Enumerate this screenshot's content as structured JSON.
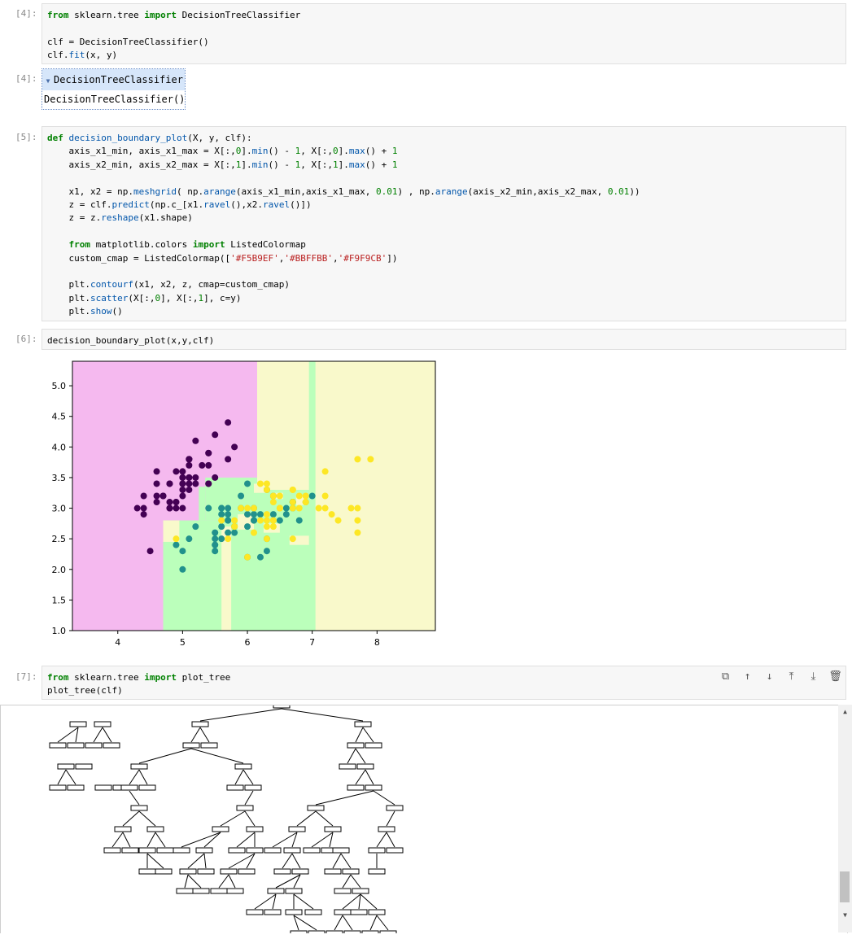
{
  "cells": {
    "c4": {
      "prompt": "[4]:",
      "out_prompt": "[4]:",
      "lines": [
        [
          [
            "kw",
            "from"
          ],
          [
            "cm",
            " sklearn.tree "
          ],
          [
            "kw",
            "import"
          ],
          [
            "cm",
            " DecisionTreeClassifier"
          ]
        ],
        [],
        [
          [
            "cm",
            "clf = DecisionTreeClassifier()"
          ]
        ],
        [
          [
            "cm",
            "clf."
          ],
          [
            "fn",
            "fit"
          ],
          [
            "cm",
            "(x, y)"
          ]
        ]
      ],
      "repr_title": "DecisionTreeClassifier",
      "repr_text": "DecisionTreeClassifier()"
    },
    "c5": {
      "prompt": "[5]:",
      "lines": [
        [
          [
            "kw",
            "def"
          ],
          [
            "cm",
            " "
          ],
          [
            "fn",
            "decision_boundary_plot"
          ],
          [
            "cm",
            "(X, y, clf):"
          ]
        ],
        [
          [
            "cm",
            "    axis_x1_min, axis_x1_max = X[:,"
          ],
          [
            "num",
            "0"
          ],
          [
            "cm",
            "]."
          ],
          [
            "fn",
            "min"
          ],
          [
            "cm",
            "() - "
          ],
          [
            "num",
            "1"
          ],
          [
            "cm",
            ", X[:,"
          ],
          [
            "num",
            "0"
          ],
          [
            "cm",
            "]."
          ],
          [
            "fn",
            "max"
          ],
          [
            "cm",
            "() + "
          ],
          [
            "num",
            "1"
          ]
        ],
        [
          [
            "cm",
            "    axis_x2_min, axis_x2_max = X[:,"
          ],
          [
            "num",
            "1"
          ],
          [
            "cm",
            "]."
          ],
          [
            "fn",
            "min"
          ],
          [
            "cm",
            "() - "
          ],
          [
            "num",
            "1"
          ],
          [
            "cm",
            ", X[:,"
          ],
          [
            "num",
            "1"
          ],
          [
            "cm",
            "]."
          ],
          [
            "fn",
            "max"
          ],
          [
            "cm",
            "() + "
          ],
          [
            "num",
            "1"
          ]
        ],
        [],
        [
          [
            "cm",
            "    x1, x2 = np."
          ],
          [
            "fn",
            "meshgrid"
          ],
          [
            "cm",
            "( np."
          ],
          [
            "fn",
            "arange"
          ],
          [
            "cm",
            "(axis_x1_min,axis_x1_max, "
          ],
          [
            "num",
            "0.01"
          ],
          [
            "cm",
            ") , np."
          ],
          [
            "fn",
            "arange"
          ],
          [
            "cm",
            "(axis_x2_min,axis_x2_max, "
          ],
          [
            "num",
            "0.01"
          ],
          [
            "cm",
            "))"
          ]
        ],
        [
          [
            "cm",
            "    z = clf."
          ],
          [
            "fn",
            "predict"
          ],
          [
            "cm",
            "(np.c_[x1."
          ],
          [
            "fn",
            "ravel"
          ],
          [
            "cm",
            "(),x2."
          ],
          [
            "fn",
            "ravel"
          ],
          [
            "cm",
            "()])"
          ]
        ],
        [
          [
            "cm",
            "    z = z."
          ],
          [
            "fn",
            "reshape"
          ],
          [
            "cm",
            "(x1.shape)"
          ]
        ],
        [],
        [
          [
            "kw",
            "    from"
          ],
          [
            "cm",
            " matplotlib.colors "
          ],
          [
            "kw",
            "import"
          ],
          [
            "cm",
            " ListedColormap"
          ]
        ],
        [
          [
            "cm",
            "    custom_cmap = ListedColormap(["
          ],
          [
            "str",
            "'#F5B9EF'"
          ],
          [
            "cm",
            ","
          ],
          [
            "str",
            "'#BBFFBB'"
          ],
          [
            "cm",
            ","
          ],
          [
            "str",
            "'#F9F9CB'"
          ],
          [
            "cm",
            "])"
          ]
        ],
        [],
        [
          [
            "cm",
            "    plt."
          ],
          [
            "fn",
            "contourf"
          ],
          [
            "cm",
            "(x1, x2, z, cmap=custom_cmap)"
          ]
        ],
        [
          [
            "cm",
            "    plt."
          ],
          [
            "fn",
            "scatter"
          ],
          [
            "cm",
            "(X[:,"
          ],
          [
            "num",
            "0"
          ],
          [
            "cm",
            "], X[:,"
          ],
          [
            "num",
            "1"
          ],
          [
            "cm",
            "], c=y)"
          ]
        ],
        [
          [
            "cm",
            "    plt."
          ],
          [
            "fn",
            "show"
          ],
          [
            "cm",
            "()"
          ]
        ]
      ]
    },
    "c6": {
      "prompt": "[6]:",
      "lines": [
        [
          [
            "cm",
            "decision_boundary_plot(x,y,clf)"
          ]
        ]
      ]
    },
    "c7": {
      "prompt": "[7]:",
      "lines": [
        [
          [
            "kw",
            "from"
          ],
          [
            "cm",
            " sklearn.tree "
          ],
          [
            "kw",
            "import"
          ],
          [
            "cm",
            " plot_tree"
          ]
        ],
        [
          [
            "cm",
            "plot_tree(clf)"
          ]
        ]
      ]
    }
  },
  "toolbar": {
    "icons": [
      "copy-icon",
      "arrow-up-icon",
      "arrow-down-icon",
      "insert-above-icon",
      "insert-below-icon",
      "trash-icon"
    ],
    "glyphs": [
      "⧉",
      "↑",
      "↓",
      "⤒",
      "⤓",
      "🗑"
    ]
  },
  "chart_data": {
    "type": "scatter",
    "title": "",
    "xlabel": "",
    "ylabel": "",
    "xlim": [
      3.3,
      8.9
    ],
    "ylim": [
      1.0,
      5.4
    ],
    "xticks": [
      "4",
      "5",
      "6",
      "7",
      "8"
    ],
    "yticks": [
      "1.0",
      "1.5",
      "2.0",
      "2.5",
      "3.0",
      "3.5",
      "4.0",
      "4.5",
      "5.0"
    ],
    "region_colors": [
      "#F5B9EF",
      "#BBFFBB",
      "#F9F9CB"
    ],
    "point_colors": [
      "#440154",
      "#21918c",
      "#fde725"
    ],
    "series": [
      {
        "class": 0,
        "points": [
          [
            5.1,
            3.5
          ],
          [
            4.9,
            3.0
          ],
          [
            4.7,
            3.2
          ],
          [
            4.6,
            3.1
          ],
          [
            5.0,
            3.6
          ],
          [
            5.4,
            3.9
          ],
          [
            4.6,
            3.4
          ],
          [
            5.0,
            3.4
          ],
          [
            4.4,
            2.9
          ],
          [
            4.9,
            3.1
          ],
          [
            5.4,
            3.7
          ],
          [
            4.8,
            3.4
          ],
          [
            4.8,
            3.0
          ],
          [
            4.3,
            3.0
          ],
          [
            5.8,
            4.0
          ],
          [
            5.7,
            4.4
          ],
          [
            5.4,
            3.9
          ],
          [
            5.1,
            3.5
          ],
          [
            5.7,
            3.8
          ],
          [
            5.1,
            3.8
          ],
          [
            5.4,
            3.4
          ],
          [
            5.1,
            3.7
          ],
          [
            4.6,
            3.6
          ],
          [
            5.1,
            3.3
          ],
          [
            4.8,
            3.4
          ],
          [
            5.0,
            3.0
          ],
          [
            5.0,
            3.4
          ],
          [
            5.2,
            3.5
          ],
          [
            5.2,
            3.4
          ],
          [
            4.7,
            3.2
          ],
          [
            4.8,
            3.1
          ],
          [
            5.4,
            3.4
          ],
          [
            5.2,
            4.1
          ],
          [
            5.5,
            4.2
          ],
          [
            4.9,
            3.1
          ],
          [
            5.0,
            3.2
          ],
          [
            5.5,
            3.5
          ],
          [
            4.9,
            3.6
          ],
          [
            4.4,
            3.0
          ],
          [
            5.1,
            3.4
          ],
          [
            5.0,
            3.5
          ],
          [
            4.5,
            2.3
          ],
          [
            4.4,
            3.2
          ],
          [
            5.0,
            3.5
          ],
          [
            5.1,
            3.8
          ],
          [
            4.8,
            3.0
          ],
          [
            5.1,
            3.8
          ],
          [
            4.6,
            3.2
          ],
          [
            5.3,
            3.7
          ],
          [
            5.0,
            3.3
          ]
        ]
      },
      {
        "class": 1,
        "points": [
          [
            7.0,
            3.2
          ],
          [
            6.4,
            3.2
          ],
          [
            6.9,
            3.1
          ],
          [
            5.5,
            2.3
          ],
          [
            6.5,
            2.8
          ],
          [
            5.7,
            2.8
          ],
          [
            6.3,
            3.3
          ],
          [
            4.9,
            2.4
          ],
          [
            6.6,
            2.9
          ],
          [
            5.2,
            2.7
          ],
          [
            5.0,
            2.0
          ],
          [
            5.9,
            3.0
          ],
          [
            6.0,
            2.2
          ],
          [
            6.1,
            2.9
          ],
          [
            5.6,
            2.9
          ],
          [
            6.7,
            3.1
          ],
          [
            5.6,
            3.0
          ],
          [
            5.8,
            2.7
          ],
          [
            6.2,
            2.2
          ],
          [
            5.6,
            2.5
          ],
          [
            5.9,
            3.2
          ],
          [
            6.1,
            2.8
          ],
          [
            6.3,
            2.5
          ],
          [
            6.1,
            2.8
          ],
          [
            6.4,
            2.9
          ],
          [
            6.6,
            3.0
          ],
          [
            6.8,
            2.8
          ],
          [
            6.7,
            3.0
          ],
          [
            6.0,
            2.9
          ],
          [
            5.7,
            2.6
          ],
          [
            5.5,
            2.4
          ],
          [
            5.5,
            2.4
          ],
          [
            5.8,
            2.7
          ],
          [
            6.0,
            2.7
          ],
          [
            5.4,
            3.0
          ],
          [
            6.0,
            3.4
          ],
          [
            6.7,
            3.1
          ],
          [
            6.3,
            2.3
          ],
          [
            5.6,
            3.0
          ],
          [
            5.5,
            2.5
          ],
          [
            5.5,
            2.6
          ],
          [
            6.1,
            3.0
          ],
          [
            5.8,
            2.6
          ],
          [
            5.0,
            2.3
          ],
          [
            5.6,
            2.7
          ],
          [
            5.7,
            3.0
          ],
          [
            5.7,
            2.9
          ],
          [
            6.2,
            2.9
          ],
          [
            5.1,
            2.5
          ],
          [
            5.7,
            2.8
          ]
        ]
      },
      {
        "class": 2,
        "points": [
          [
            6.3,
            3.3
          ],
          [
            5.8,
            2.7
          ],
          [
            7.1,
            3.0
          ],
          [
            6.3,
            2.9
          ],
          [
            6.5,
            3.0
          ],
          [
            7.6,
            3.0
          ],
          [
            4.9,
            2.5
          ],
          [
            7.3,
            2.9
          ],
          [
            6.7,
            2.5
          ],
          [
            7.2,
            3.6
          ],
          [
            6.5,
            3.2
          ],
          [
            6.4,
            2.7
          ],
          [
            6.8,
            3.0
          ],
          [
            5.7,
            2.5
          ],
          [
            5.8,
            2.8
          ],
          [
            6.4,
            3.2
          ],
          [
            6.5,
            3.0
          ],
          [
            7.7,
            3.8
          ],
          [
            7.7,
            2.6
          ],
          [
            6.0,
            2.2
          ],
          [
            6.9,
            3.2
          ],
          [
            5.6,
            2.8
          ],
          [
            7.7,
            2.8
          ],
          [
            6.3,
            2.7
          ],
          [
            6.7,
            3.3
          ],
          [
            7.2,
            3.2
          ],
          [
            6.2,
            2.8
          ],
          [
            6.1,
            3.0
          ],
          [
            6.4,
            2.8
          ],
          [
            7.2,
            3.0
          ],
          [
            7.4,
            2.8
          ],
          [
            7.9,
            3.8
          ],
          [
            6.4,
            2.8
          ],
          [
            6.3,
            2.8
          ],
          [
            6.1,
            2.6
          ],
          [
            7.7,
            3.0
          ],
          [
            6.3,
            3.4
          ],
          [
            6.4,
            3.1
          ],
          [
            6.0,
            3.0
          ],
          [
            6.9,
            3.1
          ],
          [
            6.7,
            3.1
          ],
          [
            6.9,
            3.1
          ],
          [
            5.8,
            2.7
          ],
          [
            6.8,
            3.2
          ],
          [
            6.7,
            3.3
          ],
          [
            6.7,
            3.0
          ],
          [
            6.3,
            2.5
          ],
          [
            6.5,
            3.0
          ],
          [
            6.2,
            3.4
          ],
          [
            5.9,
            3.0
          ]
        ]
      }
    ]
  }
}
